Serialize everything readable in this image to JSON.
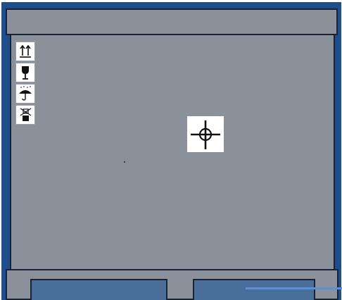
{
  "colors": {
    "frame": "#1f4e8c",
    "panel": "#8a919b",
    "outline": "#1a2333",
    "slot": "#4a6e9a",
    "accent": "#5b8fd6",
    "label_bg": "#ffffff",
    "symbol": "#111111"
  },
  "handling_labels": [
    {
      "icon": "this-way-up-arrows-icon"
    },
    {
      "icon": "fragile-glass-icon"
    },
    {
      "icon": "keep-dry-umbrella-icon"
    },
    {
      "icon": "do-not-stack-icon"
    }
  ],
  "center_mark": {
    "icon": "crosshair-target-icon"
  }
}
